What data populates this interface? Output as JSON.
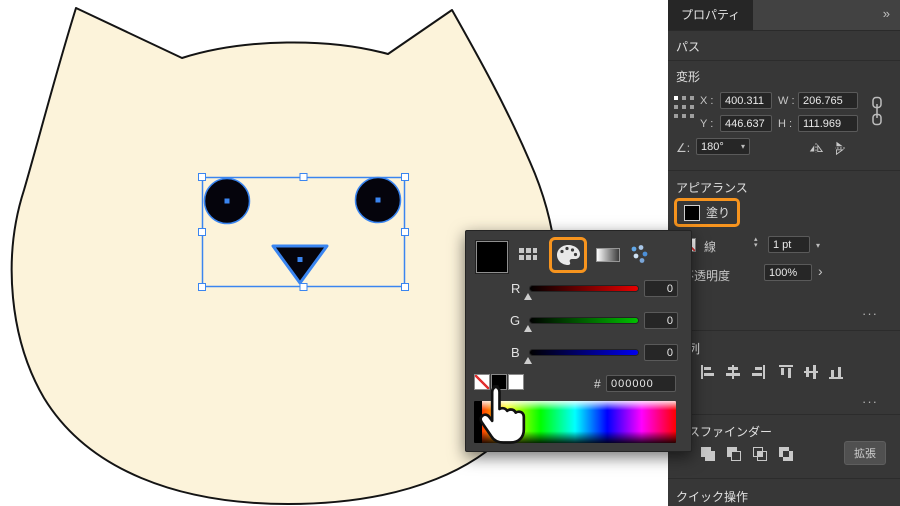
{
  "colors": {
    "cat_fill": "#fcf3da",
    "cat_stroke": "#141414",
    "selection_blue": "#3a85f0",
    "shape_black": "#05040c",
    "highlight_orange": "#f7941e"
  },
  "icons": {
    "collapse": "»",
    "dropdown": "▾",
    "spinner_up": "▴",
    "spinner_down": "▾",
    "chevron_right": "›",
    "more": "···"
  },
  "picker": {
    "channels": [
      {
        "label": "R",
        "value": "0"
      },
      {
        "label": "G",
        "value": "0"
      },
      {
        "label": "B",
        "value": "0"
      }
    ],
    "hex_label": "#",
    "hex_value": "000000"
  },
  "panel": {
    "tab": "プロパティ",
    "path_section": "パス",
    "transform": {
      "title": "変形",
      "x_label": "X :",
      "x_value": "400.311",
      "y_label": "Y :",
      "y_value": "446.637",
      "w_label": "W :",
      "w_value": "206.765",
      "h_label": "H :",
      "h_value": "111.969",
      "angle_label": "∠:",
      "angle_value": "180°"
    },
    "appearance": {
      "title": "アピアランス",
      "fill_label": "塗り",
      "stroke_label": "線",
      "stroke_value": "1 pt",
      "opacity_label": "不透明度",
      "opacity_value": "100%"
    },
    "align": {
      "title": "整列"
    },
    "pathfinder": {
      "title": "パスファインダー",
      "expand": "拡張"
    },
    "quick": {
      "title": "クイック操作"
    }
  }
}
